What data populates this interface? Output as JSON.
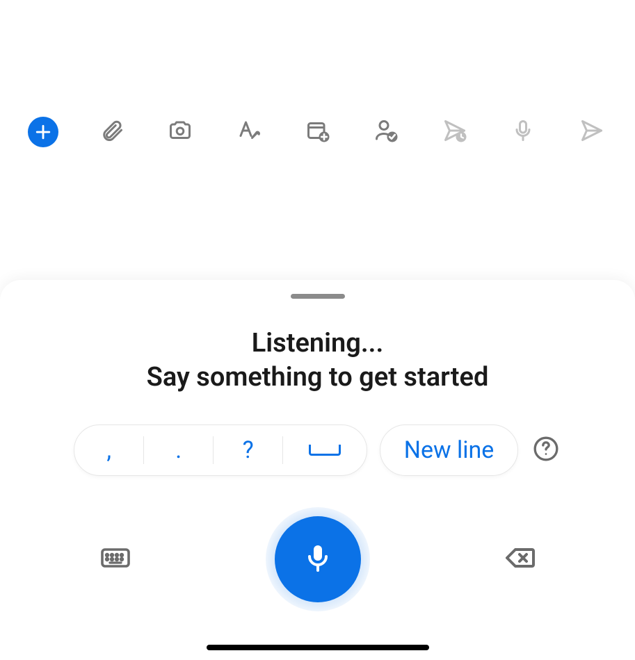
{
  "toolbar": {
    "add_icon": "plus-icon",
    "attach_icon": "paperclip-icon",
    "camera_icon": "camera-icon",
    "format_icon": "format-text-icon",
    "calendar_icon": "calendar-add-icon",
    "contact_icon": "contact-check-icon",
    "send_later_icon": "send-later-icon",
    "mic_icon": "microphone-icon",
    "send_icon": "send-icon"
  },
  "dictation": {
    "status_title": "Listening...",
    "status_subtitle": "Say something to get started",
    "punctuation": {
      "comma": ",",
      "period": ".",
      "question": "?",
      "space_label": "space"
    },
    "newline_label": "New line",
    "help_label": "?",
    "keyboard_icon": "keyboard-icon",
    "mic_button_icon": "microphone-active-icon",
    "backspace_icon": "backspace-icon"
  },
  "colors": {
    "accent": "#0b72e7",
    "icon_gray": "#7b7b7b",
    "icon_disabled": "#c0c0c0"
  }
}
